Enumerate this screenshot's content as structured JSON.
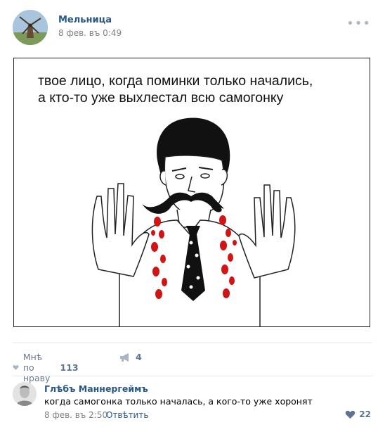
{
  "post": {
    "author": "Мельница",
    "date": "8 фев. въ 0:49",
    "more_icon": "ellipsis-icon",
    "meme_text": {
      "line1": "твое лицо, когда поминки только начались,",
      "line2": "а кто-то уже выхлестал всю самогонку"
    }
  },
  "actions": {
    "like_label": "Мнѣ по нраву",
    "like_count": "113",
    "share_count": "4"
  },
  "comment": {
    "author": "Глѣбъ Маннергеймъ",
    "text": "когда самогонка только началась, а кого-то уже хоронят",
    "date": "8 фев. въ 2:50",
    "reply_label": "Отвѣтить",
    "like_count": "22"
  },
  "colors": {
    "link": "#2a5885",
    "meta": "#828282",
    "action": "#6b7c91",
    "blood": "#d11414"
  }
}
